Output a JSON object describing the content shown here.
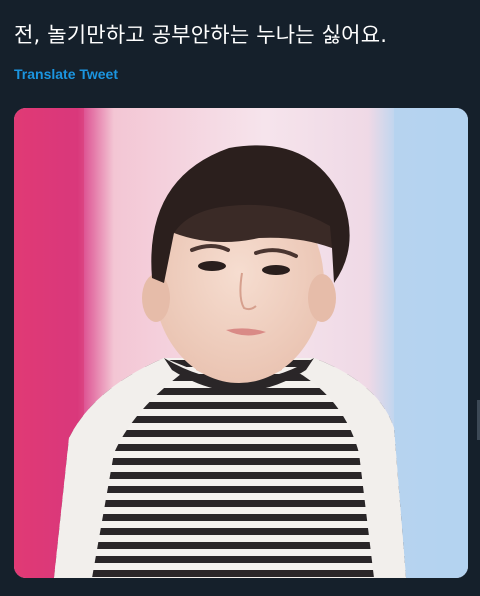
{
  "tweet": {
    "text": "전, 놀기만하고 공부안하는 누나는 싫어요.",
    "translate_label": "Translate Tweet"
  },
  "media": {
    "description_icon": "photo-of-child-in-striped-shirt"
  },
  "colors": {
    "background": "#15202b",
    "text": "#ffffff",
    "link": "#1b95e0"
  }
}
